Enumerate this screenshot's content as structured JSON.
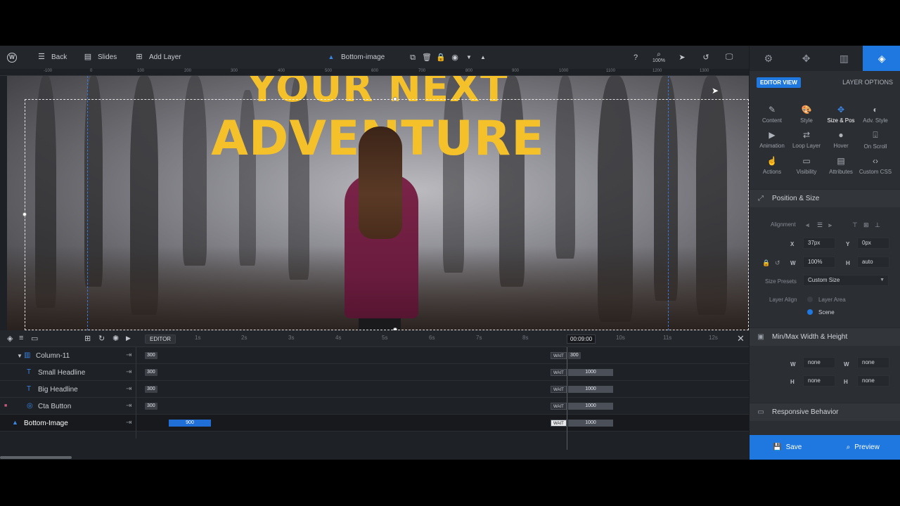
{
  "topbar": {
    "back_label": "Back",
    "slides_label": "Slides",
    "add_layer_label": "Add Layer",
    "layer_name": "Bottom-image",
    "zoom": "100%"
  },
  "ruler": {
    "ticks": [
      "-100",
      "0",
      "100",
      "200",
      "300",
      "400",
      "500",
      "600",
      "700",
      "800",
      "900",
      "1000",
      "1100",
      "1200",
      "1300"
    ]
  },
  "canvas": {
    "headline_line1": "YOUR NEXT",
    "headline_line2": "ADVENTURE",
    "headline_color": "#f5c12a"
  },
  "timeline": {
    "editor_label": "EDITOR",
    "seconds": [
      "1s",
      "2s",
      "3s",
      "4s",
      "5s",
      "6s",
      "7s",
      "8s",
      "9s",
      "10s",
      "11s",
      "12s"
    ],
    "current_time": "00:09:00",
    "wait_label": "WAIT",
    "rows": [
      {
        "name": "Column-11",
        "start": "300",
        "end": "300"
      },
      {
        "name": "Small Headline",
        "start": "300",
        "end": "1000"
      },
      {
        "name": "Big Headline",
        "start": "300",
        "end": "1000"
      },
      {
        "name": "Cta Button",
        "start": "300",
        "end": "1000"
      },
      {
        "name": "Bottom-Image",
        "start": "900",
        "end": "1000"
      }
    ]
  },
  "panel": {
    "editor_view": "EDITOR VIEW",
    "layer_options": "LAYER OPTIONS",
    "grid": [
      "Content",
      "Style",
      "Size & Pos",
      "Adv. Style",
      "Animation",
      "Loop Layer",
      "Hover",
      "On Scroll",
      "Actions",
      "Visibility",
      "Attributes",
      "Custom CSS"
    ],
    "position_size": "Position & Size",
    "alignment_label": "Alignment",
    "x_label": "X",
    "x_value": "37px",
    "y_label": "Y",
    "y_value": "0px",
    "w_label": "W",
    "w_value": "100%",
    "h_label": "H",
    "h_value": "auto",
    "size_presets_label": "Size Presets",
    "size_presets_value": "Custom Size",
    "layer_align_label": "Layer Align",
    "layer_area": "Layer Area",
    "scene": "Scene",
    "minmax": "Min/Max Width & Height",
    "min_w": "none",
    "max_w": "none",
    "min_h": "none",
    "max_h": "none",
    "responsive": "Responsive Behavior",
    "save": "Save",
    "preview": "Preview"
  }
}
